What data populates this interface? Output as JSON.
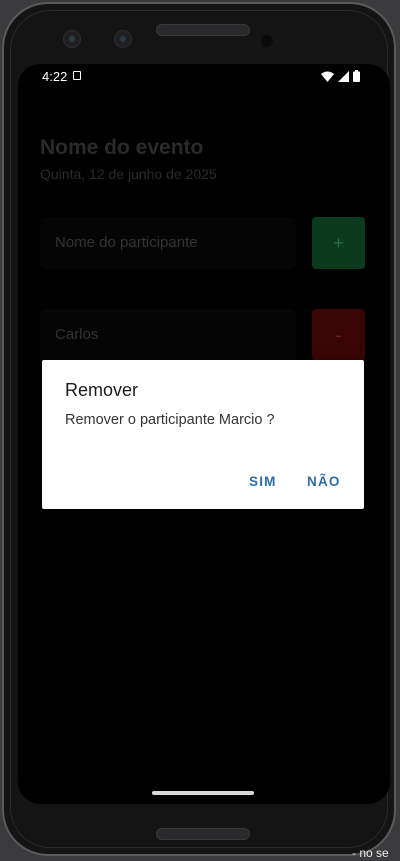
{
  "status_bar": {
    "time": "4:22"
  },
  "event": {
    "title": "Nome do evento",
    "date": "Quinta, 12 de junho de 2025"
  },
  "form": {
    "participant_placeholder": "Nome do participante",
    "add_label": "+"
  },
  "participants": [
    {
      "name": "Carlos",
      "remove_label": "-"
    }
  ],
  "dialog": {
    "title": "Remover",
    "message": "Remover o participante Marcio ?",
    "confirm_label": "SIM",
    "cancel_label": "NÃO"
  },
  "footer": {
    "partial_text": "- no se"
  },
  "colors": {
    "dialog_action": "#2f6fa5",
    "add_button": "#0b3a1d",
    "remove_button": "#3a0505"
  }
}
